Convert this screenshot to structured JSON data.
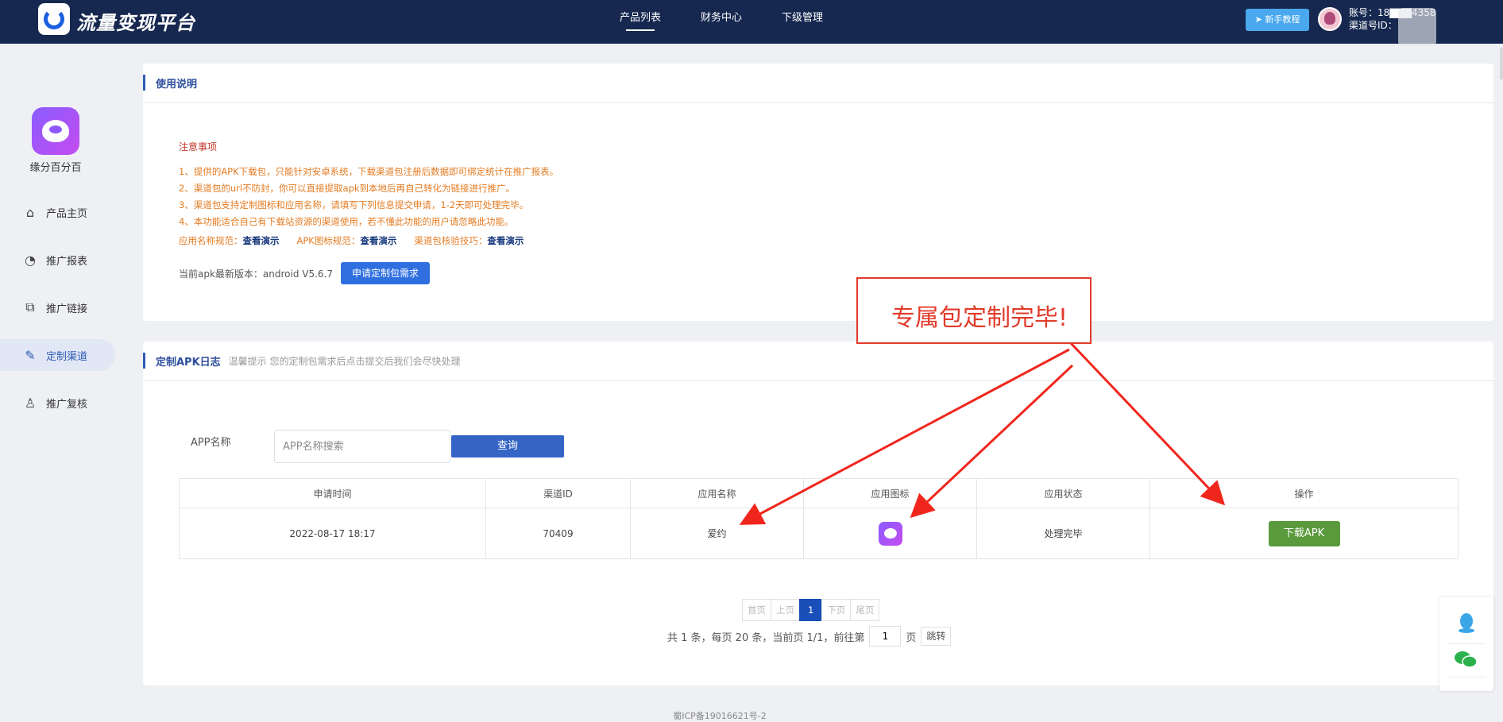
{
  "header": {
    "logo_text": "流量变现平台",
    "nav": [
      "产品列表",
      "财务中心",
      "下级管理"
    ],
    "guide_label": "新手教程",
    "account_label": "账号：18▇▇▇4358",
    "channel_label": "渠道号ID："
  },
  "sidebar": {
    "app_name": "缘分百分百",
    "items": [
      {
        "label": "产品主页",
        "icon": "home-icon"
      },
      {
        "label": "推广报表",
        "icon": "report-icon"
      },
      {
        "label": "推广链接",
        "icon": "link-icon"
      },
      {
        "label": "定制渠道",
        "icon": "custom-channel-icon"
      },
      {
        "label": "推广复核",
        "icon": "review-icon"
      }
    ],
    "active_index": 3
  },
  "usage_card": {
    "title": "使用说明",
    "notice_title": "注意事项",
    "notices": [
      "1、提供的APK下载包，只能针对安卓系统，下载渠道包注册后数据即可绑定统计在推广报表。",
      "2、渠道包的url不防封，你可以直接提取apk到本地后再自己转化为链接进行推广。",
      "3、渠道包支持定制图标和应用名称，请填写下列信息提交申请，1-2天即可处理完毕。",
      "4、本功能适合自己有下载站资源的渠道使用，若不懂此功能的用户请忽略此功能。"
    ],
    "specs": [
      {
        "label": "应用名称规范：",
        "link": "查看演示"
      },
      {
        "label": "APK图标规范：",
        "link": "查看演示"
      },
      {
        "label": "渠道包核验技巧：",
        "link": "查看演示"
      }
    ],
    "version_text": "当前apk最新版本：android V5.6.7",
    "apply_label": "申请定制包需求"
  },
  "log_card": {
    "title": "定制APK日志",
    "tip": "温馨提示 您的定制包需求后点击提交后我们会尽快处理",
    "search_label": "APP名称",
    "search_placeholder": "APP名称搜索",
    "search_button": "查询",
    "columns": [
      "申请时间",
      "渠道ID",
      "应用名称",
      "应用图标",
      "应用状态",
      "操作"
    ],
    "rows": [
      {
        "time": "2022-08-17 18:17",
        "channel_id": "70409",
        "app_name": "爱约",
        "status": "处理完毕",
        "action": "下载APK"
      }
    ],
    "pager": {
      "first": "首页",
      "prev": "上页",
      "current": "1",
      "next": "下页",
      "last": "尾页",
      "summary": "共 1 条，每页 20 条，当前页 1/1，前往第",
      "page_suffix": "页",
      "jump_value": "1",
      "jump_label": "跳转"
    }
  },
  "callout": {
    "text": "专属包定制完毕!"
  },
  "footer": {
    "icp": "蜀ICP备19016621号-2"
  },
  "colors": {
    "nav_bg": "#16284f",
    "accent": "#2f5bb5",
    "download_btn": "#5a9a3c",
    "callout_red": "#e23a2a"
  }
}
